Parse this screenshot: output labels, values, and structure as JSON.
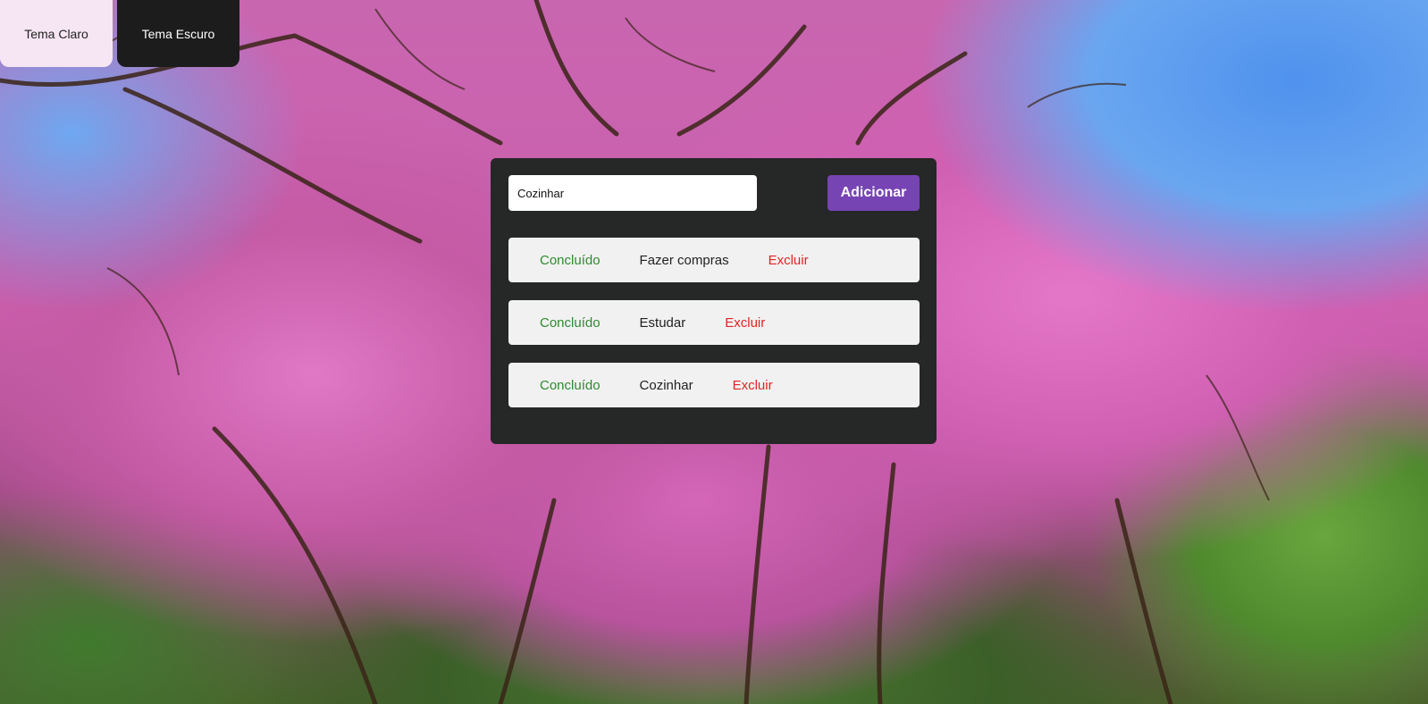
{
  "theme_buttons": {
    "light_label": "Tema Claro",
    "dark_label": "Tema Escuro"
  },
  "todo": {
    "input_value": "Cozinhar",
    "add_label": "Adicionar",
    "items": [
      {
        "done_label": "Concluído",
        "text": "Fazer compras",
        "delete_label": "Excluir"
      },
      {
        "done_label": "Concluído",
        "text": "Estudar",
        "delete_label": "Excluir"
      },
      {
        "done_label": "Concluído",
        "text": "Cozinhar",
        "delete_label": "Excluir"
      }
    ]
  },
  "colors": {
    "accent": "#7744b4",
    "done": "#2e8b2e",
    "delete": "#e22424",
    "panel": "#262727"
  }
}
